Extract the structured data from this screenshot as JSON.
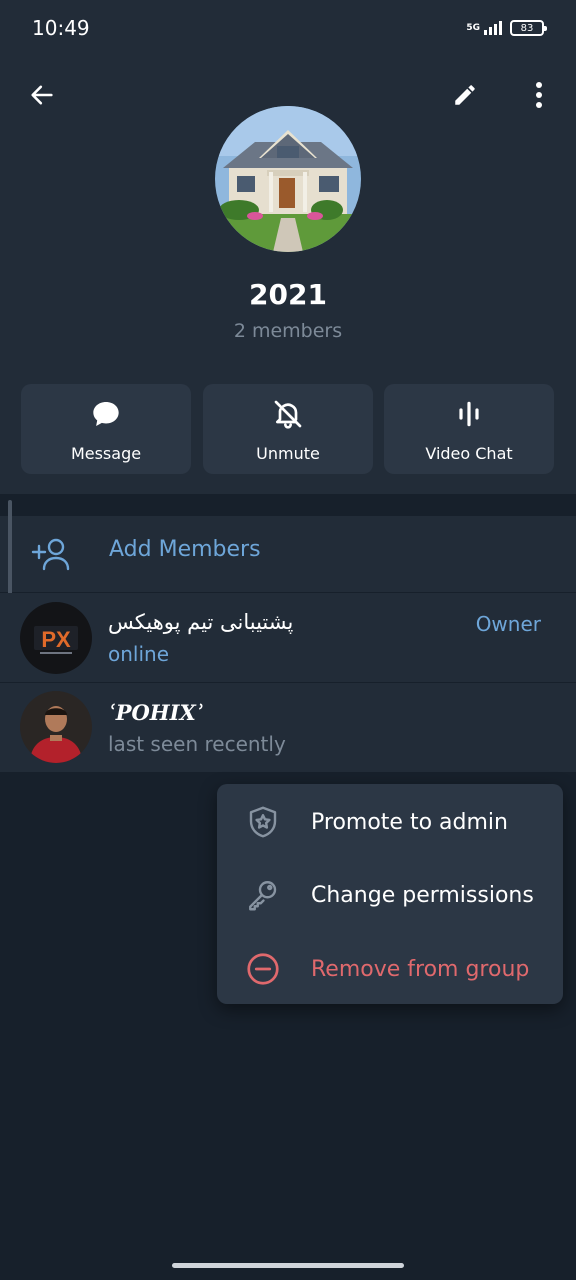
{
  "status_bar": {
    "time": "10:49",
    "network": "5G",
    "battery": "83"
  },
  "toolbar": {
    "back_icon": "arrow-left-icon",
    "edit_icon": "pencil-icon",
    "more_icon": "kebab-menu-icon"
  },
  "group": {
    "title": "2021",
    "subtitle": "2 members"
  },
  "actions": [
    {
      "label": "Message",
      "icon": "chat-bubble-icon"
    },
    {
      "label": "Unmute",
      "icon": "bell-off-icon"
    },
    {
      "label": "Video Chat",
      "icon": "voice-waves-icon"
    }
  ],
  "add_members": {
    "label": "Add Members",
    "icon": "add-person-icon"
  },
  "members": [
    {
      "name": "پشتیبانی تیم پوهیکس",
      "status": "online",
      "role": "Owner"
    },
    {
      "name": "ʿPOHIXʾ",
      "status": "last seen recently",
      "role": ""
    }
  ],
  "context_menu": [
    {
      "label": "Promote to admin",
      "icon": "shield-star-icon"
    },
    {
      "label": "Change permissions",
      "icon": "key-icon"
    },
    {
      "label": "Remove from group",
      "icon": "minus-circle-icon"
    }
  ],
  "colors": {
    "background": "#17202b",
    "surface": "#222c38",
    "card": "#2c3745",
    "accent": "#6ea6d9",
    "muted": "#7d8a98",
    "danger": "#e0696d"
  }
}
